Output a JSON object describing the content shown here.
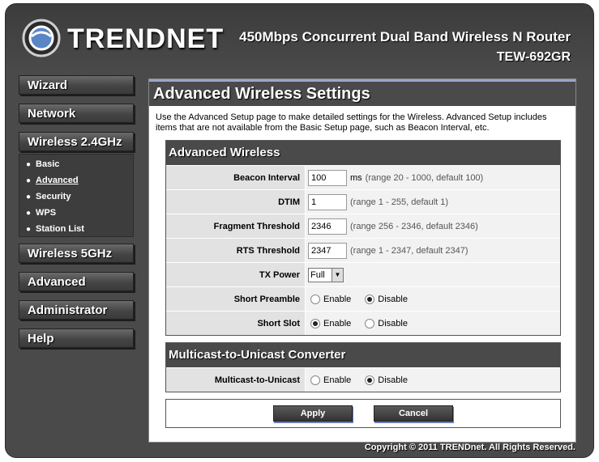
{
  "header": {
    "brand": "TRENDNET",
    "product_title": "450Mbps Concurrent Dual Band Wireless N Router",
    "model": "TEW-692GR"
  },
  "nav": {
    "items": [
      {
        "label": "Wizard"
      },
      {
        "label": "Network"
      },
      {
        "label": "Wireless 2.4GHz"
      },
      {
        "label": "Wireless 5GHz"
      },
      {
        "label": "Advanced"
      },
      {
        "label": "Administrator"
      },
      {
        "label": "Help"
      }
    ],
    "submenu": [
      {
        "label": "Basic"
      },
      {
        "label": "Advanced"
      },
      {
        "label": "Security"
      },
      {
        "label": "WPS"
      },
      {
        "label": "Station List"
      }
    ]
  },
  "page": {
    "title": "Advanced Wireless Settings",
    "intro": "Use the Advanced Setup page to make detailed settings for the Wireless. Advanced Setup includes items that are not available from the Basic Setup page, such as Beacon Interval, etc."
  },
  "advanced_wireless": {
    "heading": "Advanced Wireless",
    "beacon": {
      "label": "Beacon Interval",
      "value": "100",
      "unit": "ms",
      "hint": "(range 20 - 1000, default 100)"
    },
    "dtim": {
      "label": "DTIM",
      "value": "1",
      "hint": "(range 1 - 255, default 1)"
    },
    "fragment": {
      "label": "Fragment Threshold",
      "value": "2346",
      "hint": "(range 256 - 2346, default 2346)"
    },
    "rts": {
      "label": "RTS Threshold",
      "value": "2347",
      "hint": "(range 1 - 2347, default 2347)"
    },
    "tx_power": {
      "label": "TX Power",
      "value": "Full"
    },
    "short_preamble": {
      "label": "Short Preamble",
      "enable": "Enable",
      "disable": "Disable",
      "selected": "Disable"
    },
    "short_slot": {
      "label": "Short Slot",
      "enable": "Enable",
      "disable": "Disable",
      "selected": "Enable"
    }
  },
  "multicast": {
    "heading": "Multicast-to-Unicast Converter",
    "row": {
      "label": "Multicast-to-Unicast",
      "enable": "Enable",
      "disable": "Disable",
      "selected": "Disable"
    }
  },
  "buttons": {
    "apply": "Apply",
    "cancel": "Cancel"
  },
  "footer": "Copyright © 2011 TRENDnet. All Rights Reserved.",
  "colors": {
    "frame": "#4a4a4a",
    "title_accent": "#9aa6c8",
    "button_shadow": "#6a7dbd"
  }
}
